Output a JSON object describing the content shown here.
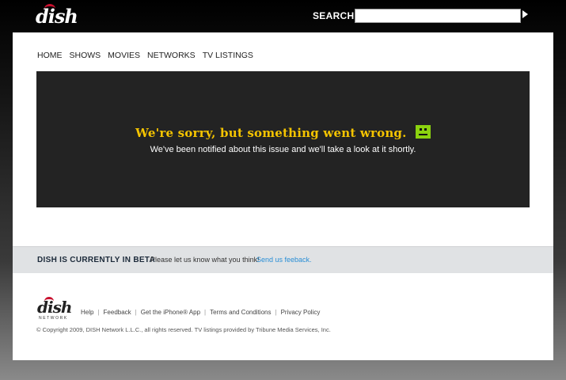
{
  "header": {
    "logo_text": "dish",
    "search_label": "SEARCH",
    "search_value": ""
  },
  "nav": [
    "HOME",
    "SHOWS",
    "MOVIES",
    "NETWORKS",
    "TV LISTINGS"
  ],
  "error": {
    "title": "We're sorry, but something went wrong.",
    "message": "We've been notified about this issue and we'll take a look at it shortly.",
    "icon": "sad-face-icon",
    "title_color": "#f5c400",
    "icon_color": "#8bd20f"
  },
  "beta": {
    "title": "DISH IS CURRENTLY IN BETA",
    "message": "Please let us know what you think!",
    "link": "Send us feeback."
  },
  "footer": {
    "logo_text": "dish",
    "logo_subtext": "NETWORK",
    "links": [
      "Help",
      "Feedback",
      "Get the iPhone® App",
      "Terms and Conditions",
      "Privacy Policy"
    ],
    "copyright": "© Copyright 2009, DISH Network L.L.C., all rights reserved. TV listings provided by Tribune Media Services, Inc."
  },
  "colors": {
    "brand_red": "#c8102e",
    "link_blue": "#2a8fd6"
  }
}
